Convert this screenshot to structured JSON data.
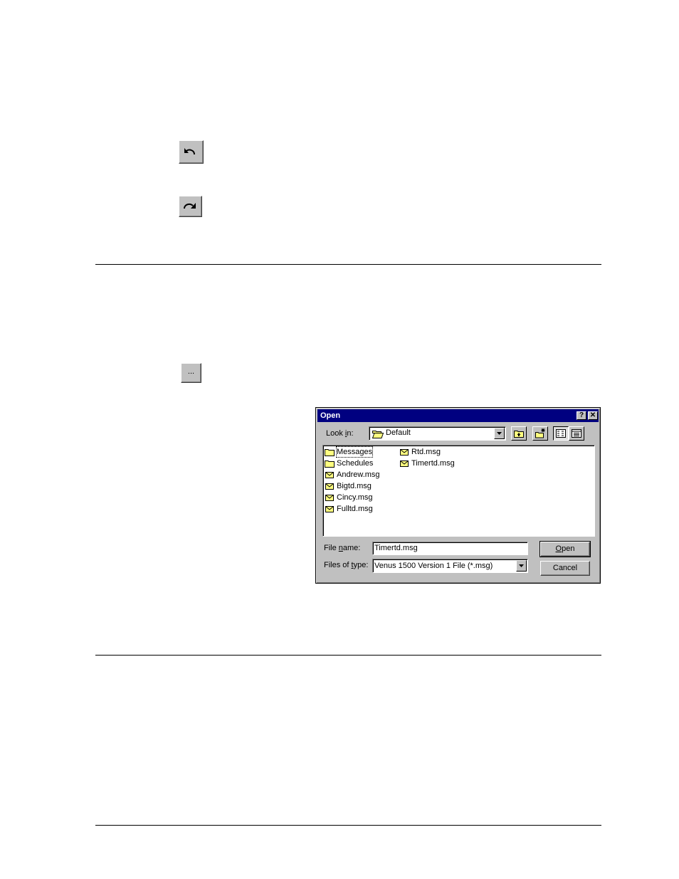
{
  "toolbar_buttons": {
    "undo_icon": "undo-arrow-icon",
    "redo_icon": "redo-arrow-icon",
    "browse_label": "..."
  },
  "dialog": {
    "title": "Open",
    "help_label": "?",
    "close_label": "✕",
    "lookin": {
      "label_pre": "Look ",
      "label_accel": "i",
      "label_post": "n:",
      "value": "Default"
    },
    "files": [
      {
        "name": "Messages",
        "type": "folder"
      },
      {
        "name": "Schedules",
        "type": "folder"
      },
      {
        "name": "Andrew.msg",
        "type": "msg"
      },
      {
        "name": "Bigtd.msg",
        "type": "msg"
      },
      {
        "name": "Cincy.msg",
        "type": "msg"
      },
      {
        "name": "Fulltd.msg",
        "type": "msg"
      },
      {
        "name": "Rtd.msg",
        "type": "msg"
      },
      {
        "name": "Timertd.msg",
        "type": "msg"
      }
    ],
    "filename": {
      "label_pre": "File ",
      "label_accel": "n",
      "label_post": "ame:",
      "value": "Timertd.msg"
    },
    "filetype": {
      "label_pre": "Files of ",
      "label_accel": "t",
      "label_post": "ype:",
      "value": "Venus 1500 Version 1 File (*.msg)"
    },
    "open_button": {
      "accel": "O",
      "rest": "pen"
    },
    "cancel_button": "Cancel"
  },
  "colors": {
    "titlebar": "#000080",
    "face": "#c0c0c0",
    "folder": "#ffff80"
  }
}
